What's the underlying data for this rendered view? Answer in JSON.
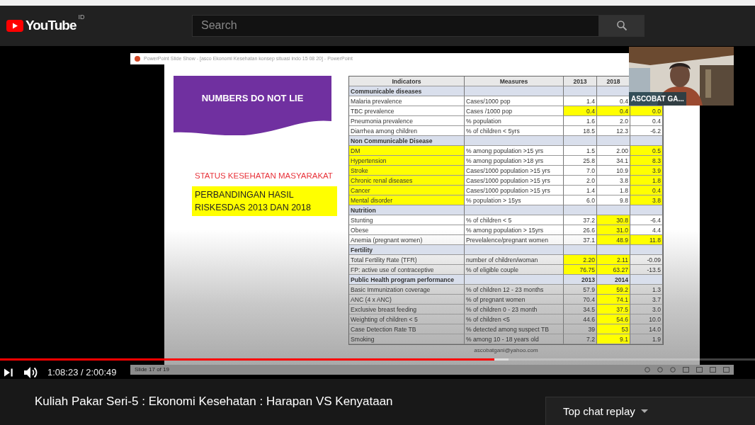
{
  "header": {
    "logo": "YouTube",
    "region": "ID",
    "search": {
      "placeholder": "Search"
    }
  },
  "video": {
    "window_title": "PowerPoint Slide Show - [asco Ekonomi Kesehatan konsep situasi indo 15 08 20] - PowerPoint",
    "slide": {
      "banner": "NUMBERS DO NOT LIE",
      "subtitle": "STATUS KESEHATAN MASYARAKAT",
      "note": "PERBANDINGAN HASIL RISKESDAS 2013 DAN 2018",
      "email": "ascobatgani@yahoo.com",
      "table": {
        "columns": [
          "Indicators",
          "Measures",
          "2013",
          "2018"
        ],
        "rows": [
          {
            "kind": "section",
            "label": "Communicable diseases"
          },
          {
            "kind": "data",
            "cells": [
              "Malaria prevalence",
              "Cases/1000 pop",
              "1.4",
              "0.4"
            ],
            "highlight": [
              false,
              false,
              false,
              false
            ]
          },
          {
            "kind": "data",
            "cells": [
              "TBC prevalence",
              "Cases /1000 pop",
              "0.4",
              "0.4",
              "0.0"
            ],
            "highlight": [
              false,
              false,
              true,
              true,
              true
            ]
          },
          {
            "kind": "data",
            "cells": [
              "Pneumonia prevalence",
              "% population",
              "1.6",
              "2.0",
              "0.4"
            ],
            "highlight": [
              false,
              false,
              false,
              false,
              false
            ]
          },
          {
            "kind": "data",
            "cells": [
              "Diarrhea among children",
              "% of children < 5yrs",
              "18.5",
              "12.3",
              "-6.2"
            ],
            "highlight": [
              false,
              false,
              false,
              false,
              false
            ]
          },
          {
            "kind": "section",
            "label": "Non Communicable Disease"
          },
          {
            "kind": "data",
            "cells": [
              "DM",
              "% among population >15 yrs",
              "1.5",
              "2.00",
              "0.5"
            ],
            "highlight": [
              true,
              false,
              false,
              false,
              true
            ]
          },
          {
            "kind": "data",
            "cells": [
              "Hypertension",
              "% among population >18 yrs",
              "25.8",
              "34.1",
              "8.3"
            ],
            "highlight": [
              true,
              false,
              false,
              false,
              true
            ]
          },
          {
            "kind": "data",
            "cells": [
              "Stroke",
              "Cases/1000 population >15 yrs",
              "7.0",
              "10.9",
              "3.9"
            ],
            "highlight": [
              true,
              false,
              false,
              false,
              true
            ]
          },
          {
            "kind": "data",
            "cells": [
              "Chronic renal diseases",
              "Cases/1000 population >15 yrs",
              "2.0",
              "3.8",
              "1.8"
            ],
            "highlight": [
              true,
              false,
              false,
              false,
              true
            ]
          },
          {
            "kind": "data",
            "cells": [
              "Cancer",
              "Cases/1000 population >15 yrs",
              "1.4",
              "1.8",
              "0.4"
            ],
            "highlight": [
              true,
              false,
              false,
              false,
              true
            ]
          },
          {
            "kind": "data",
            "cells": [
              "Mental disorder",
              "% population > 15ys",
              "6.0",
              "9.8",
              "3.8"
            ],
            "highlight": [
              true,
              false,
              false,
              false,
              true
            ]
          },
          {
            "kind": "section",
            "label": "Nutrition"
          },
          {
            "kind": "data",
            "cells": [
              "Stunting",
              "% of children < 5",
              "37.2",
              "30.8",
              "-6.4"
            ],
            "highlight": [
              false,
              false,
              false,
              true,
              false
            ]
          },
          {
            "kind": "data",
            "cells": [
              "Obese",
              "% among population > 15yrs",
              "26.6",
              "31.0",
              "4.4"
            ],
            "highlight": [
              false,
              false,
              false,
              true,
              false
            ]
          },
          {
            "kind": "data",
            "cells": [
              "Anemia (pregnant women)",
              "Prevelalence/pregnant women",
              "37.1",
              "48.9",
              "11.8"
            ],
            "highlight": [
              false,
              false,
              false,
              true,
              true
            ]
          },
          {
            "kind": "section",
            "label": "Fertility"
          },
          {
            "kind": "data",
            "cells": [
              "Total Fertility Rate (TFR)",
              "number of children/woman",
              "2.20",
              "2.11",
              "-0.09"
            ],
            "highlight": [
              false,
              false,
              true,
              true,
              false
            ]
          },
          {
            "kind": "data",
            "cells": [
              "FP: active use of contraceptive",
              "% of eligible couple",
              "76.75",
              "63.27",
              "-13.5"
            ],
            "highlight": [
              false,
              false,
              true,
              true,
              false
            ]
          },
          {
            "kind": "section",
            "label": "Public Health program performance",
            "years": [
              "2013",
              "2014"
            ]
          },
          {
            "kind": "data",
            "cells": [
              "Basic Immunization coverage",
              "% of children 12 - 23 months",
              "57.9",
              "59.2",
              "1.3"
            ],
            "highlight": [
              false,
              false,
              false,
              true,
              false
            ]
          },
          {
            "kind": "data",
            "cells": [
              "ANC (4 x ANC)",
              "% of pregnant women",
              "70.4",
              "74.1",
              "3.7"
            ],
            "highlight": [
              false,
              false,
              false,
              true,
              false
            ]
          },
          {
            "kind": "data",
            "cells": [
              "Exclusive breast feeding",
              "% of children 0 - 23 month",
              "34.5",
              "37.5",
              "3.0"
            ],
            "highlight": [
              false,
              false,
              false,
              true,
              false
            ]
          },
          {
            "kind": "data",
            "cells": [
              "Weighting of children < 5",
              "% of children <5",
              "44.6",
              "54.6",
              "10.0"
            ],
            "highlight": [
              false,
              false,
              false,
              true,
              false
            ]
          },
          {
            "kind": "data",
            "cells": [
              "Case Detection Rate TB",
              "% detected among suspect TB",
              "39",
              "53",
              "14.0"
            ],
            "highlight": [
              false,
              false,
              false,
              true,
              false
            ]
          },
          {
            "kind": "data",
            "cells": [
              "Smoking",
              "% among 10 - 18 years old",
              "7.2",
              "9.1",
              "1.9"
            ],
            "highlight": [
              false,
              false,
              false,
              true,
              false
            ]
          }
        ]
      }
    },
    "status": "Slide 17 of 19",
    "webcam": {
      "name": "ASCOBAT GA..."
    },
    "progress": {
      "level": 0.655
    },
    "buffered": {
      "level": 0.674
    },
    "time": "1:08:23 / 2:00:49"
  },
  "title": "Kuliah Pakar Seri-5 : Ekonomi Kesehatan : Harapan VS Kenyataan",
  "chat": {
    "label": "Top chat replay"
  }
}
